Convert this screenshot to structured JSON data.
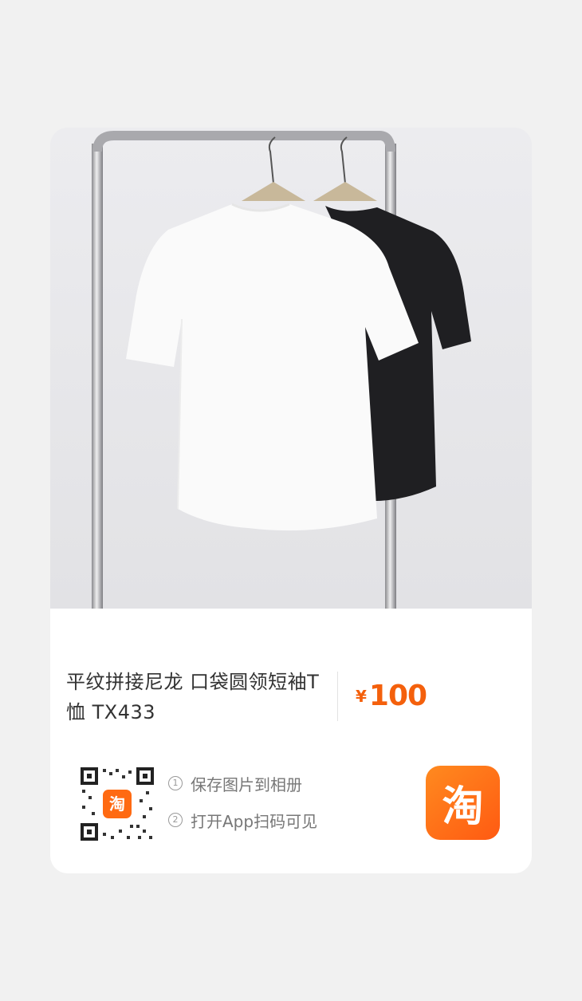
{
  "product": {
    "title": "平纹拼接尼龙 口袋圆领短袖T恤 TX433",
    "currency": "¥",
    "price": "100"
  },
  "steps": [
    {
      "num": "1",
      "text": "保存图片到相册"
    },
    {
      "num": "2",
      "text": "打开App扫码可见"
    }
  ],
  "qr_badge": "淘",
  "app_logo": "淘",
  "colors": {
    "accent": "#f4600c",
    "logo_gradient_start": "#ff8a1f",
    "logo_gradient_end": "#ff5a12",
    "background": "#f1f1f1"
  },
  "icons": [
    "qr-code-icon",
    "taobao-logo-icon"
  ]
}
